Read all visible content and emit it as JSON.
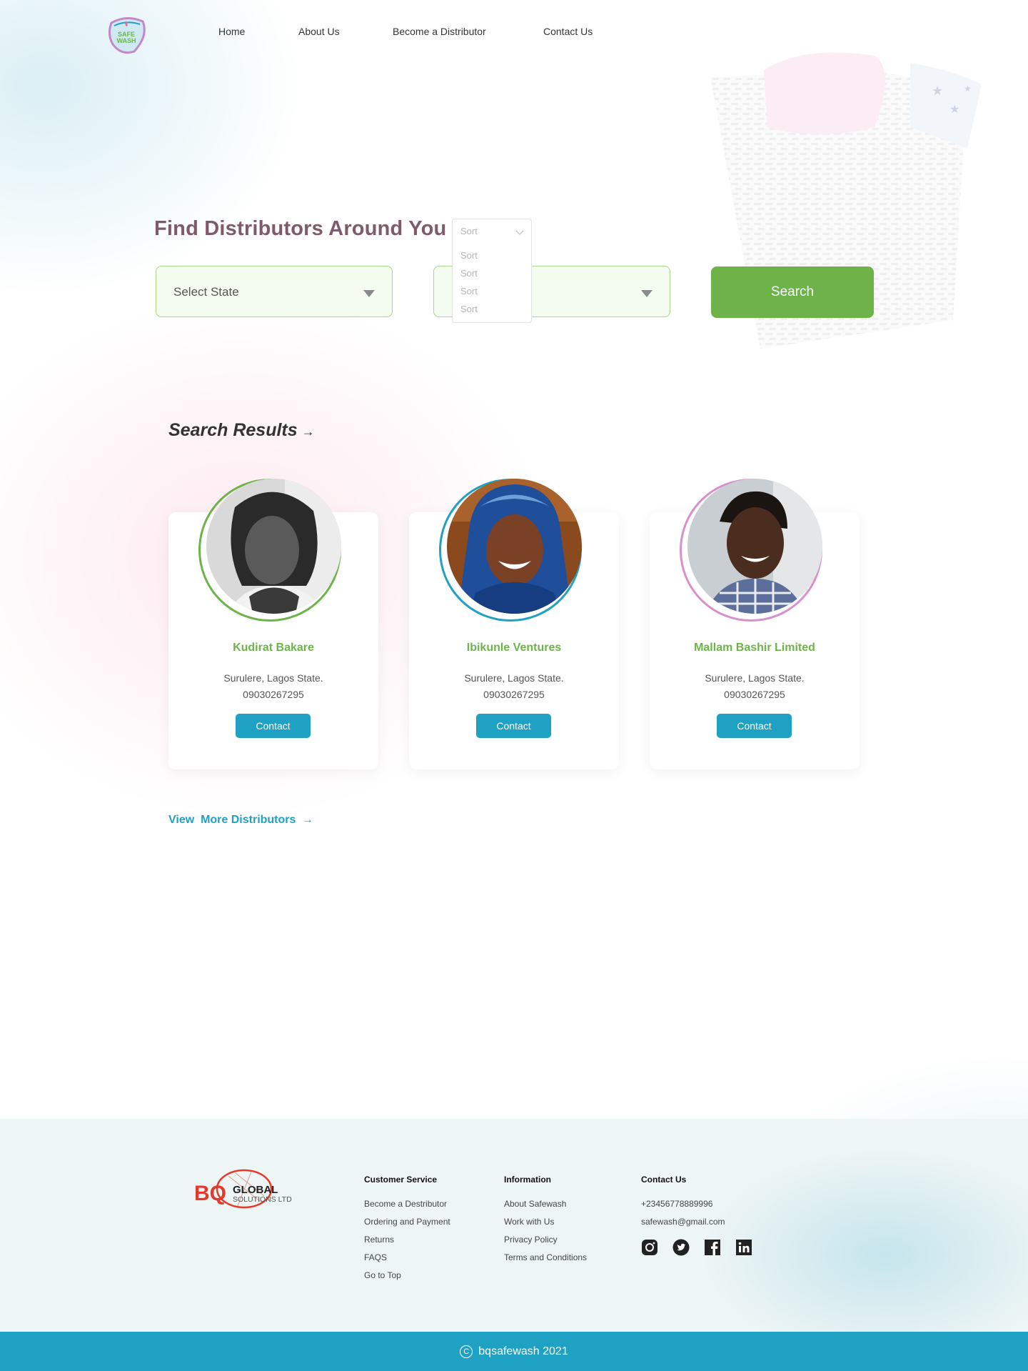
{
  "brand": {
    "logo_text_1": "SAFE",
    "logo_text_2": "WASH"
  },
  "nav": [
    {
      "label": "Home"
    },
    {
      "label": "About Us"
    },
    {
      "label": "Become a Distributor"
    },
    {
      "label": "Contact Us"
    }
  ],
  "finder": {
    "title": "Find Distributors Around You",
    "state_select": "Select State",
    "search_label": "Search",
    "sort": {
      "value": "Sort",
      "options": [
        "Sort",
        "Sort",
        "Sort",
        "Sort"
      ]
    }
  },
  "results": {
    "title": "Search Results",
    "cards": [
      {
        "name": "Kudirat Bakare",
        "location": "Surulere, Lagos State.",
        "phone": "09030267295",
        "button": "Contact",
        "ring_color": "#6db34a"
      },
      {
        "name": "Ibikunle Ventures",
        "location": "Surulere, Lagos State.",
        "phone": "09030267295",
        "button": "Contact",
        "ring_color": "#1fa1c3"
      },
      {
        "name": "Mallam Bashir Limited",
        "location": "Surulere, Lagos State.",
        "phone": "09030267295",
        "button": "Contact",
        "ring_color": "#d98fcc"
      }
    ],
    "view_more": "View  More Distributors"
  },
  "footer": {
    "company_logo": {
      "mark": "BQ",
      "line1": "GLOBAL",
      "line2": "SOLUTIONS LTD"
    },
    "customer_service": {
      "heading": "Customer Service",
      "links": [
        "Become a Destributor",
        "Ordering and Payment",
        "Returns",
        "FAQS",
        "Go to Top"
      ]
    },
    "information": {
      "heading": "Information",
      "links": [
        "About Safewash",
        "Work with Us",
        "Privacy Policy",
        "Terms and Conditions"
      ]
    },
    "contact": {
      "heading": "Contact Us",
      "phone": "+23456778889996",
      "email": "safewash@gmail.com"
    },
    "socials": [
      "instagram-icon",
      "twitter-icon",
      "facebook-icon",
      "linkedin-icon"
    ],
    "copyright": "bqsafewash 2021"
  },
  "colors": {
    "accent_green": "#6db34a",
    "accent_blue": "#1fa1c3",
    "title_mauve": "#7e5a6b"
  }
}
